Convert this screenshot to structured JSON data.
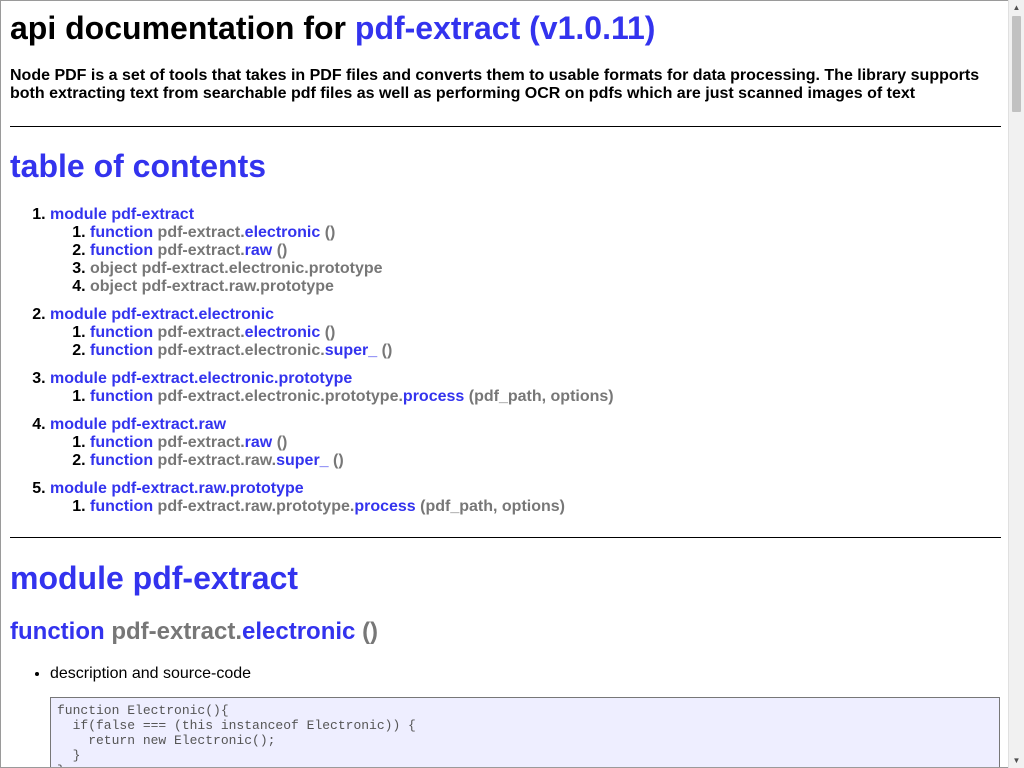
{
  "header": {
    "title_prefix": "api documentation for",
    "title_link": "pdf-extract (v1.0.11)",
    "description": "Node PDF is a set of tools that takes in PDF files and converts them to usable formats for data processing. The library supports both extracting text from searchable pdf files as well as performing OCR on pdfs which are just scanned images of text"
  },
  "toc": {
    "heading": "table of contents",
    "modules": [
      {
        "label": "module pdf-extract",
        "items": [
          {
            "kind": "function",
            "prefix": "pdf-extract.",
            "name": "electronic",
            "args": "()"
          },
          {
            "kind": "function",
            "prefix": "pdf-extract.",
            "name": "raw",
            "args": "()"
          },
          {
            "kind": "object",
            "prefix": "pdf-extract.electronic.prototype",
            "name": "",
            "args": ""
          },
          {
            "kind": "object",
            "prefix": "pdf-extract.raw.prototype",
            "name": "",
            "args": ""
          }
        ]
      },
      {
        "label": "module pdf-extract.electronic",
        "items": [
          {
            "kind": "function",
            "prefix": "pdf-extract.",
            "name": "electronic",
            "args": "()"
          },
          {
            "kind": "function",
            "prefix": "pdf-extract.electronic.",
            "name": "super_",
            "args": "()"
          }
        ]
      },
      {
        "label": "module pdf-extract.electronic.prototype",
        "items": [
          {
            "kind": "function",
            "prefix": "pdf-extract.electronic.prototype.",
            "name": "process",
            "args": "(pdf_path, options)"
          }
        ]
      },
      {
        "label": "module pdf-extract.raw",
        "items": [
          {
            "kind": "function",
            "prefix": "pdf-extract.",
            "name": "raw",
            "args": "()"
          },
          {
            "kind": "function",
            "prefix": "pdf-extract.raw.",
            "name": "super_",
            "args": "()"
          }
        ]
      },
      {
        "label": "module pdf-extract.raw.prototype",
        "items": [
          {
            "kind": "function",
            "prefix": "pdf-extract.raw.prototype.",
            "name": "process",
            "args": "(pdf_path, options)"
          }
        ]
      }
    ]
  },
  "section": {
    "module_heading": "module pdf-extract",
    "function_kind": "function",
    "function_prefix": "pdf-extract.",
    "function_name": "electronic",
    "function_args": "()",
    "desc_label": "description and source-code",
    "code": "function Electronic(){\n  if(false === (this instanceof Electronic)) {\n    return new Electronic();\n  }\n}"
  },
  "colors": {
    "link": "#3333ee",
    "muted": "#777777",
    "code_bg": "#eeeeff"
  }
}
